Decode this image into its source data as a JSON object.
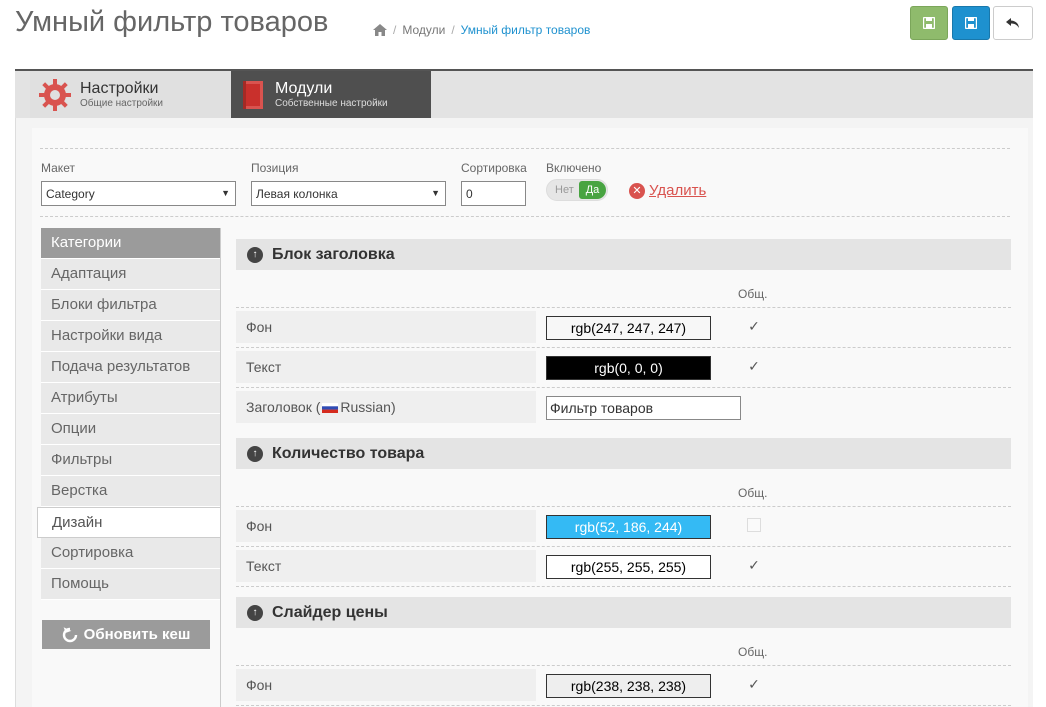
{
  "header": {
    "title": "Умный фильтр товаров",
    "breadcrumb": [
      "Модули",
      "Умный фильтр товаров"
    ]
  },
  "tabs": [
    {
      "title": "Настройки",
      "subtitle": "Общие настройки",
      "icon": "gear-icon"
    },
    {
      "title": "Модули",
      "subtitle": "Собственные настройки",
      "icon": "module-icon"
    }
  ],
  "form": {
    "layout_label": "Макет",
    "layout_value": "Category",
    "position_label": "Позиция",
    "position_value": "Левая колонка",
    "sort_label": "Сортировка",
    "sort_value": "0",
    "enabled_label": "Включено",
    "enabled_no": "Нет",
    "enabled_yes": "Да",
    "delete_label": "Удалить"
  },
  "nav": {
    "header": "Категории",
    "items": [
      "Адаптация",
      "Блоки фильтра",
      "Настройки вида",
      "Подача результатов",
      "Атрибуты",
      "Опции",
      "Фильтры",
      "Верстка",
      "Дизайн",
      "Сортировка",
      "Помощь"
    ],
    "active": "Дизайн",
    "refresh_label": "Обновить кеш"
  },
  "sections": [
    {
      "title": "Блок заголовка",
      "common_label": "Общ.",
      "rows": [
        {
          "label": "Фон",
          "value": "rgb(247, 247, 247)",
          "bg": "#f7f7f7",
          "fg": "#000000",
          "checked": true
        },
        {
          "label": "Текст",
          "value": "rgb(0, 0, 0)",
          "bg": "#000000",
          "fg": "#ffffff",
          "checked": true
        }
      ],
      "title_row": {
        "label_prefix": "Заголовок (",
        "language": "Russian)",
        "value": "Фильтр товаров"
      }
    },
    {
      "title": "Количество товара",
      "common_label": "Общ.",
      "rows": [
        {
          "label": "Фон",
          "value": "rgb(52, 186, 244)",
          "bg": "#34baf4",
          "fg": "#ffffff",
          "checked": false
        },
        {
          "label": "Текст",
          "value": "rgb(255, 255, 255)",
          "bg": "#ffffff",
          "fg": "#000000",
          "checked": true
        }
      ]
    },
    {
      "title": "Слайдер цены",
      "common_label": "Общ.",
      "rows": [
        {
          "label": "Фон",
          "value": "rgb(238, 238, 238)",
          "bg": "#eeeeee",
          "fg": "#000000",
          "checked": true
        }
      ]
    }
  ]
}
